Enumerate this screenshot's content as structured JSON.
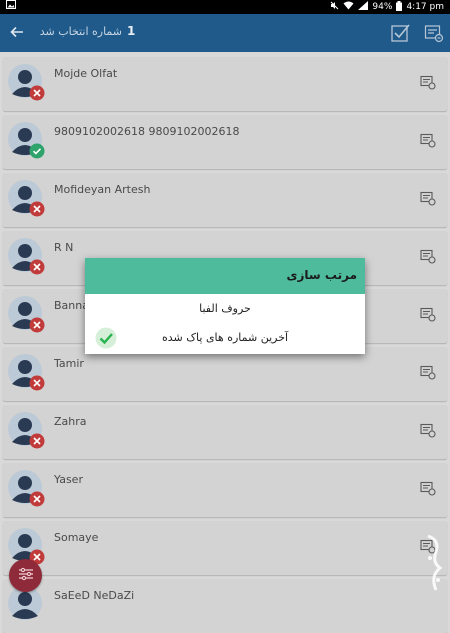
{
  "status_bar": {
    "battery": "94%",
    "time": "4:17 pm"
  },
  "app_bar": {
    "selected_count": "1",
    "selected_text": "شماره انتخاب شد"
  },
  "contacts": [
    {
      "name": "Mojde Olfat",
      "status": "error"
    },
    {
      "name": "9809102002618 9809102002618",
      "status": "ok"
    },
    {
      "name": "Mofideyan Artesh",
      "status": "error"
    },
    {
      "name": "R N",
      "status": "error"
    },
    {
      "name": "Banna",
      "status": "error"
    },
    {
      "name": "Tamir",
      "status": "error"
    },
    {
      "name": "Zahra",
      "status": "error"
    },
    {
      "name": "Yaser",
      "status": "error"
    },
    {
      "name": "Somaye",
      "status": "error"
    },
    {
      "name": "SaEeD NeDaZi",
      "status": "error"
    }
  ],
  "dialog": {
    "title": "مرتب سازی",
    "options": [
      {
        "label": "حروف الفبا",
        "selected": false
      },
      {
        "label": "آخرین شماره های پاک شده",
        "selected": true
      }
    ]
  },
  "colors": {
    "app_bar": "#1f5a8a",
    "dialog_header": "#4dbb9c",
    "badge_error": "#c23b3b",
    "badge_ok": "#2ea36b",
    "fab": "#8e2a3a",
    "check": "#27b34d"
  },
  "icons": {
    "back": "arrow-left-icon",
    "check_all": "check-square-icon",
    "list_edit": "list-edit-icon",
    "row_action": "contact-card-icon",
    "fab": "sort-filter-icon"
  }
}
